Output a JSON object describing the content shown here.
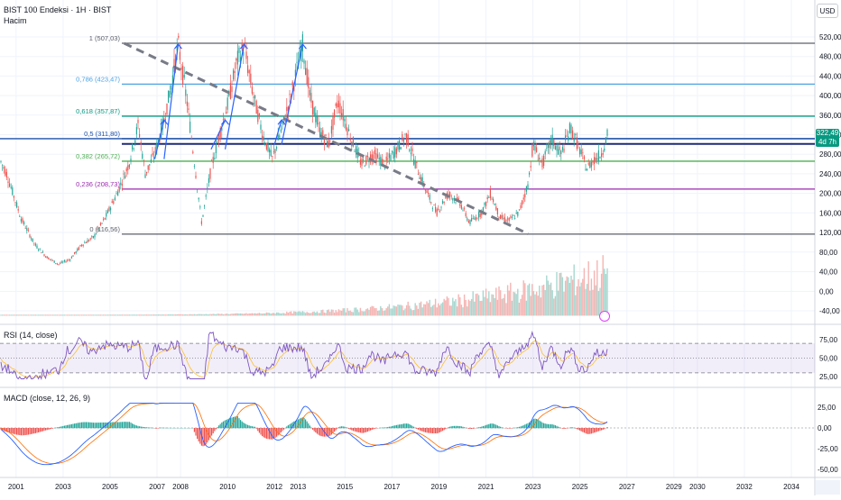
{
  "header": {
    "title": "BIST 100 Endeksi · 1H · BIST",
    "volume_label": "Hacim",
    "currency": "USD"
  },
  "price_tag": {
    "value": "322,49",
    "countdown": "4d 7h"
  },
  "colors": {
    "up": "#26a69a",
    "down": "#ef5350",
    "rsi": "#7e57c2",
    "macd": "#2962ff",
    "signal": "#ff6d00",
    "grid": "#f0f3fa",
    "trend": "#787b86",
    "arrow": "#2962ff"
  },
  "fib_levels": [
    {
      "label": "1 (507,03)",
      "value": 507.03,
      "color": "#5d606b"
    },
    {
      "label": "0,786 (423,47)",
      "value": 423.47,
      "color": "#4ba3e3"
    },
    {
      "label": "0,618 (357,87)",
      "value": 357.87,
      "color": "#089981"
    },
    {
      "label": "0,5 (311,80)",
      "value": 311.8,
      "color": "#1e4fa8"
    },
    {
      "label": "0,382 (265,72)",
      "value": 265.72,
      "color": "#4caf50"
    },
    {
      "label": "0,236 (208,73)",
      "value": 208.73,
      "color": "#9c27b0"
    },
    {
      "label": "0 (116,56)",
      "value": 116.56,
      "color": "#5d606b"
    }
  ],
  "extra_level": {
    "value": 301
  },
  "chart_data": [
    {
      "type": "candlestick",
      "title": "BIST 100 Endeksi · 1H · BIST",
      "ylim": [
        20,
        540
      ],
      "y_ticks": [
        "520,00",
        "480,00",
        "440,00",
        "400,00",
        "360,00",
        "320,00",
        "280,00",
        "240,00",
        "200,00",
        "160,00",
        "120,00",
        "80,00",
        "40,00",
        "0,00",
        "-40,00"
      ],
      "x_ticks": [
        "2001",
        "2003",
        "2005",
        "2007",
        "2008",
        "2010",
        "2012",
        "2013",
        "2015",
        "2017",
        "2019",
        "2021",
        "2023",
        "2025",
        "2027",
        "2029",
        "2030",
        "2032",
        "2034"
      ],
      "close_path": [
        [
          2000.0,
          300
        ],
        [
          2000.6,
          240
        ],
        [
          2001.2,
          150
        ],
        [
          2001.8,
          95
        ],
        [
          2002.3,
          70
        ],
        [
          2002.8,
          55
        ],
        [
          2003.3,
          65
        ],
        [
          2003.8,
          95
        ],
        [
          2004.3,
          110
        ],
        [
          2004.8,
          150
        ],
        [
          2005.3,
          200
        ],
        [
          2005.8,
          260
        ],
        [
          2006.2,
          340
        ],
        [
          2006.5,
          240
        ],
        [
          2006.9,
          280
        ],
        [
          2007.3,
          350
        ],
        [
          2007.6,
          420
        ],
        [
          2007.9,
          505
        ],
        [
          2008.3,
          380
        ],
        [
          2008.7,
          220
        ],
        [
          2008.9,
          140
        ],
        [
          2009.3,
          250
        ],
        [
          2009.7,
          330
        ],
        [
          2010.0,
          380
        ],
        [
          2010.4,
          470
        ],
        [
          2010.7,
          500
        ],
        [
          2011.1,
          400
        ],
        [
          2011.5,
          320
        ],
        [
          2011.9,
          270
        ],
        [
          2012.3,
          330
        ],
        [
          2012.7,
          400
        ],
        [
          2013.2,
          505
        ],
        [
          2013.5,
          400
        ],
        [
          2013.9,
          330
        ],
        [
          2014.3,
          300
        ],
        [
          2014.7,
          390
        ],
        [
          2015.2,
          320
        ],
        [
          2015.7,
          260
        ],
        [
          2016.2,
          280
        ],
        [
          2016.7,
          260
        ],
        [
          2017.2,
          290
        ],
        [
          2017.6,
          320
        ],
        [
          2018.0,
          260
        ],
        [
          2018.5,
          200
        ],
        [
          2018.9,
          160
        ],
        [
          2019.4,
          200
        ],
        [
          2019.9,
          180
        ],
        [
          2020.3,
          140
        ],
        [
          2020.8,
          160
        ],
        [
          2021.2,
          200
        ],
        [
          2021.6,
          150
        ],
        [
          2022.0,
          145
        ],
        [
          2022.4,
          160
        ],
        [
          2022.8,
          220
        ],
        [
          2023.0,
          300
        ],
        [
          2023.4,
          260
        ],
        [
          2023.8,
          310
        ],
        [
          2024.2,
          280
        ],
        [
          2024.6,
          335
        ],
        [
          2024.9,
          300
        ],
        [
          2025.3,
          250
        ],
        [
          2025.6,
          270
        ],
        [
          2025.9,
          280
        ],
        [
          2026.2,
          322.49
        ]
      ]
    },
    {
      "type": "bar",
      "title": "Hacim",
      "ylim": [
        -60,
        100
      ],
      "y_ticks": [
        "80,00",
        "40,00",
        "0,00",
        "-40,00"
      ]
    },
    {
      "type": "line",
      "title": "RSI (14, close)",
      "ylim": [
        15,
        85
      ],
      "y_ticks": [
        "75,00",
        "50,00",
        "25,00"
      ],
      "bands": [
        70,
        30
      ]
    },
    {
      "type": "line",
      "title": "MACD (close, 12, 26, 9)",
      "ylim": [
        -55,
        35
      ],
      "y_ticks": [
        "25,00",
        "0,00",
        "-25,00",
        "-50,00"
      ]
    }
  ]
}
